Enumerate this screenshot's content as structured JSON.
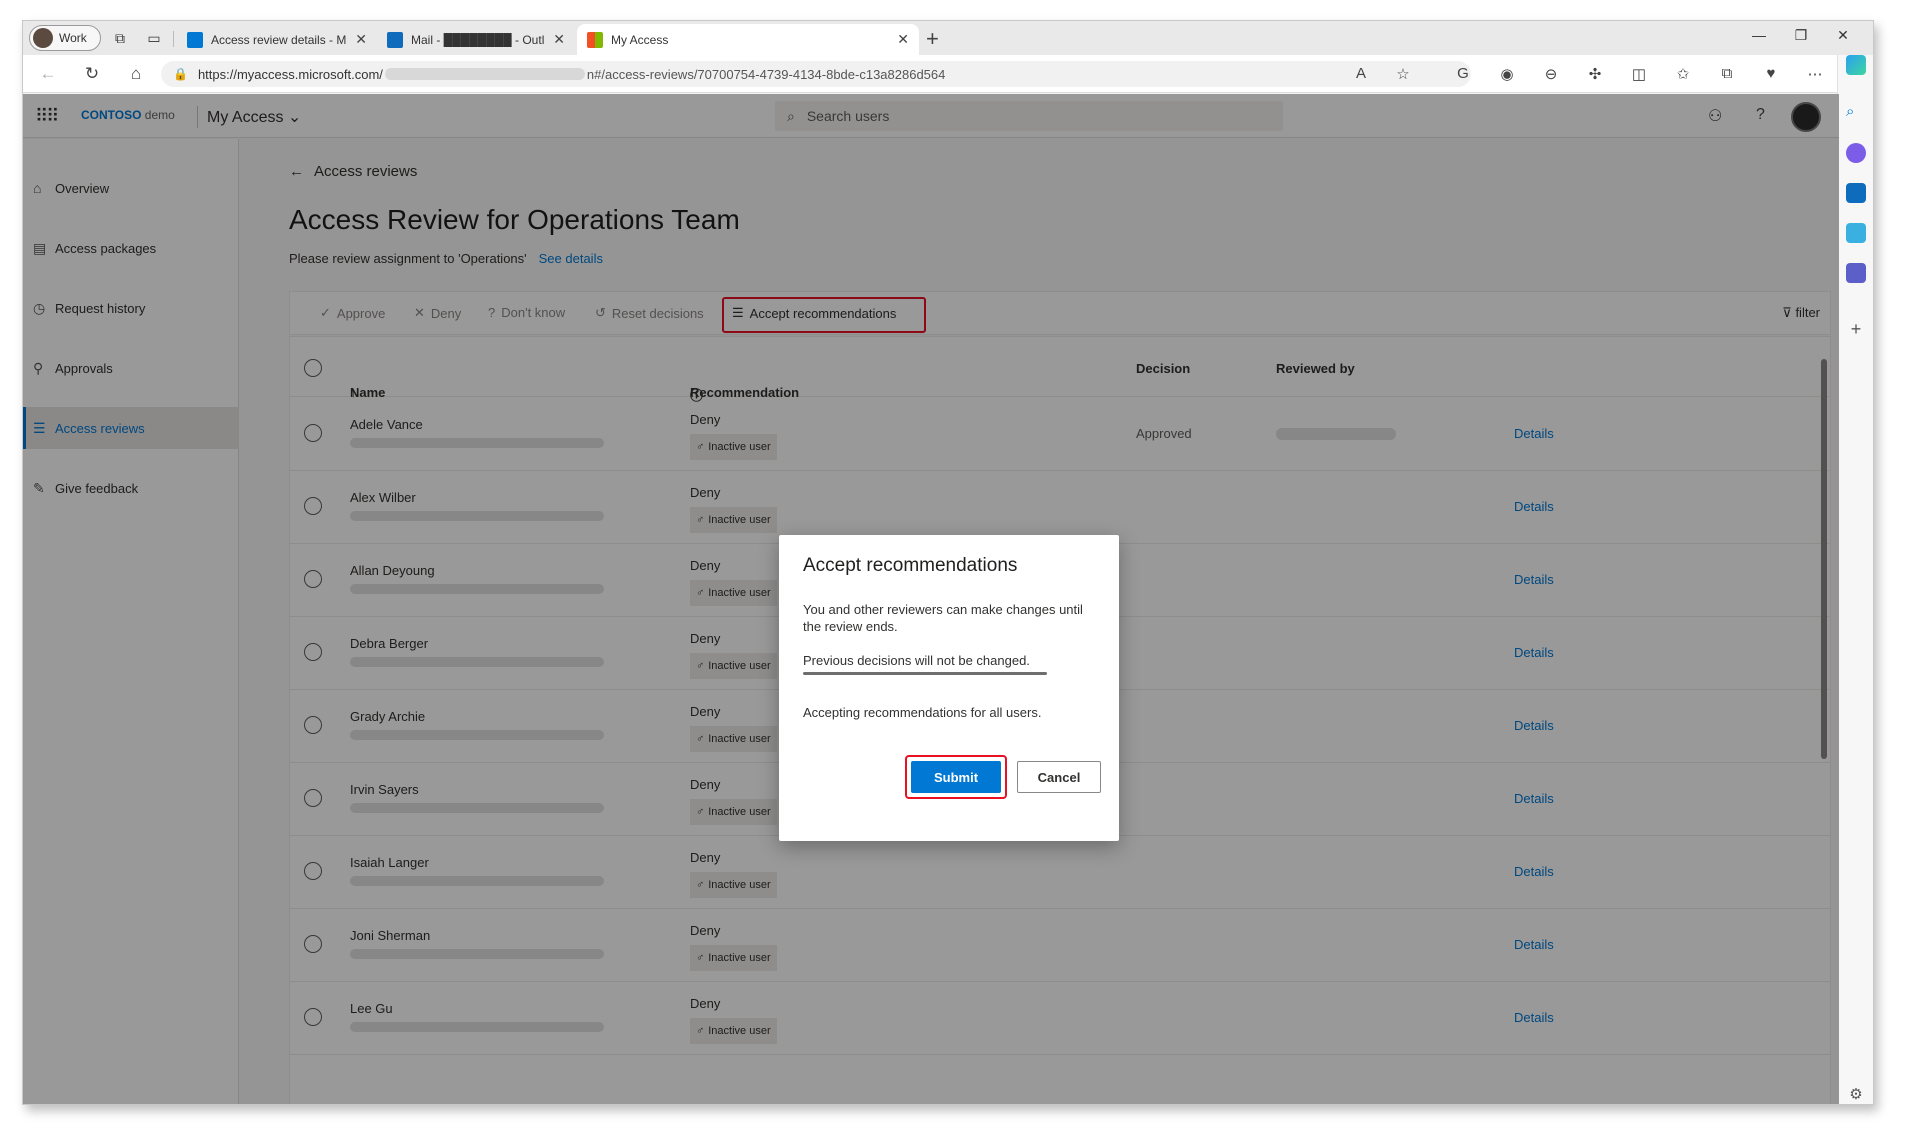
{
  "browser": {
    "profile_label": "Work",
    "tabs": [
      {
        "title": "Access review details - Microsoft",
        "color": "#0078d4"
      },
      {
        "title": "Mail - ████████ - Outl",
        "color": "#0f6cbd"
      },
      {
        "title": "My Access",
        "color": "#f25022"
      }
    ],
    "url": {
      "prefix": "https://myaccess.microsoft.com/",
      "path": "n#/access-reviews/70700754-4739-4134-8bde-c13a8286d564"
    }
  },
  "app": {
    "logo_brand": "CONTOSO",
    "logo_suffix": "demo",
    "name": "My Access",
    "search_placeholder": "Search users"
  },
  "nav": {
    "items": [
      {
        "label": "Overview",
        "icon": "home-icon"
      },
      {
        "label": "Access packages",
        "icon": "package-icon"
      },
      {
        "label": "Request history",
        "icon": "history-icon"
      },
      {
        "label": "Approvals",
        "icon": "person-icon"
      },
      {
        "label": "Access reviews",
        "icon": "checklist-icon",
        "active": true
      },
      {
        "label": "Give feedback",
        "icon": "feedback-icon"
      }
    ]
  },
  "page": {
    "back_label": "Access reviews",
    "title": "Access Review for Operations Team",
    "subtitle": "Please review assignment to 'Operations'",
    "see_details": "See details"
  },
  "toolbar": {
    "approve": "Approve",
    "deny": "Deny",
    "dont_know": "Don't know",
    "reset": "Reset decisions",
    "accept": "Accept recommendations",
    "filter": "filter"
  },
  "table": {
    "headers": {
      "name": "Name",
      "recommendation": "Recommendation",
      "decision": "Decision",
      "reviewed_by": "Reviewed by"
    },
    "details_label": "Details",
    "rows": [
      {
        "name": "Adele Vance",
        "recommendation": "Deny",
        "badge": "Inactive user",
        "decision": "Approved"
      },
      {
        "name": "Alex Wilber",
        "recommendation": "Deny",
        "badge": "Inactive user",
        "decision": ""
      },
      {
        "name": "Allan Deyoung",
        "recommendation": "Deny",
        "badge": "Inactive user",
        "decision": ""
      },
      {
        "name": "Debra Berger",
        "recommendation": "Deny",
        "badge": "Inactive user",
        "decision": ""
      },
      {
        "name": "Grady Archie",
        "recommendation": "Deny",
        "badge": "Inactive user",
        "decision": ""
      },
      {
        "name": "Irvin Sayers",
        "recommendation": "Deny",
        "badge": "Inactive user",
        "decision": ""
      },
      {
        "name": "Isaiah Langer",
        "recommendation": "Deny",
        "badge": "Inactive user",
        "decision": ""
      },
      {
        "name": "Joni Sherman",
        "recommendation": "Deny",
        "badge": "Inactive user",
        "decision": ""
      },
      {
        "name": "Lee Gu",
        "recommendation": "Deny",
        "badge": "Inactive user",
        "decision": ""
      }
    ]
  },
  "dialog": {
    "title": "Accept recommendations",
    "text1": "You and other reviewers can make changes until the review ends.",
    "text2": "Previous decisions will not be changed.",
    "text3": "Accepting recommendations for all users.",
    "submit": "Submit",
    "cancel": "Cancel"
  },
  "colors": {
    "accent": "#0078d4",
    "highlight": "#e81123"
  }
}
